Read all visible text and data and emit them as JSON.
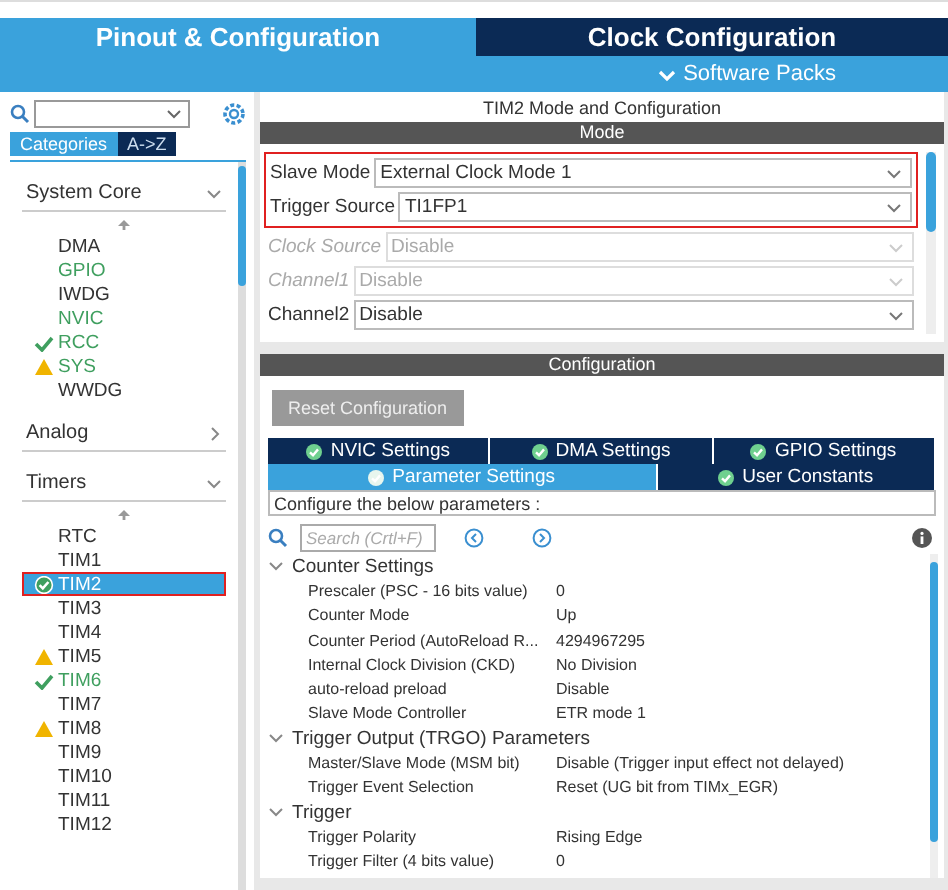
{
  "header": {
    "tabs": [
      {
        "label": "Pinout & Configuration",
        "selected": true
      },
      {
        "label": "Clock Configuration",
        "selected": false
      }
    ],
    "software_packs": "Software Packs"
  },
  "sidebar": {
    "tabs": [
      {
        "label": "Categories",
        "selected": true
      },
      {
        "label": "A->Z",
        "selected": false
      }
    ],
    "groups": [
      {
        "label": "System Core",
        "expanded": true,
        "items": [
          {
            "label": "DMA",
            "kind": "plain",
            "active": false,
            "selected": false,
            "annotated": false
          },
          {
            "label": "GPIO",
            "kind": "plain",
            "active": true,
            "selected": false,
            "annotated": false
          },
          {
            "label": "IWDG",
            "kind": "plain",
            "active": false,
            "selected": false,
            "annotated": false
          },
          {
            "label": "NVIC",
            "kind": "plain",
            "active": true,
            "selected": false,
            "annotated": false
          },
          {
            "label": "RCC",
            "kind": "ok",
            "active": true,
            "selected": false,
            "annotated": false
          },
          {
            "label": "SYS",
            "kind": "warning",
            "active": true,
            "selected": false,
            "annotated": false
          },
          {
            "label": "WWDG",
            "kind": "plain",
            "active": false,
            "selected": false,
            "annotated": false
          }
        ]
      },
      {
        "label": "Analog",
        "expanded": false
      },
      {
        "label": "Timers",
        "expanded": true,
        "items": [
          {
            "label": "RTC",
            "kind": "plain",
            "active": false,
            "selected": false,
            "annotated": false
          },
          {
            "label": "TIM1",
            "kind": "plain",
            "active": false,
            "selected": false,
            "annotated": false
          },
          {
            "label": "TIM2",
            "kind": "configured",
            "active": true,
            "selected": true,
            "annotated": true
          },
          {
            "label": "TIM3",
            "kind": "plain",
            "active": false,
            "selected": false,
            "annotated": false
          },
          {
            "label": "TIM4",
            "kind": "plain",
            "active": false,
            "selected": false,
            "annotated": false
          },
          {
            "label": "TIM5",
            "kind": "warning",
            "active": false,
            "selected": false,
            "annotated": false
          },
          {
            "label": "TIM6",
            "kind": "ok",
            "active": true,
            "selected": false,
            "annotated": false
          },
          {
            "label": "TIM7",
            "kind": "plain",
            "active": false,
            "selected": false,
            "annotated": false
          },
          {
            "label": "TIM8",
            "kind": "warning",
            "active": false,
            "selected": false,
            "annotated": false
          },
          {
            "label": "TIM9",
            "kind": "plain",
            "active": false,
            "selected": false,
            "annotated": false
          },
          {
            "label": "TIM10",
            "kind": "plain",
            "active": false,
            "selected": false,
            "annotated": false
          },
          {
            "label": "TIM11",
            "kind": "plain",
            "active": false,
            "selected": false,
            "annotated": false
          },
          {
            "label": "TIM12",
            "kind": "plain",
            "active": false,
            "selected": false,
            "annotated": false
          }
        ]
      }
    ]
  },
  "main": {
    "title": "TIM2 Mode and Configuration",
    "mode_heading": "Mode",
    "fields": [
      {
        "label": "Slave Mode",
        "value": "External Clock Mode 1",
        "disabled": false,
        "annotated": true
      },
      {
        "label": "Trigger Source",
        "value": "TI1FP1",
        "disabled": false,
        "annotated": true
      },
      {
        "label": "Clock Source",
        "value": "Disable",
        "disabled": true,
        "annotated": false
      },
      {
        "label": "Channel1",
        "value": "Disable",
        "disabled": true,
        "annotated": false
      },
      {
        "label": "Channel2",
        "value": "Disable",
        "disabled": false,
        "annotated": false
      }
    ],
    "config_heading": "Configuration",
    "reset_button": {
      "label": "Reset Configuration",
      "disabled": true
    },
    "tab_rows": [
      [
        {
          "label": "NVIC Settings",
          "selected": false
        },
        {
          "label": "DMA Settings",
          "selected": false
        },
        {
          "label": "GPIO Settings",
          "selected": false
        }
      ],
      [
        {
          "label": "Parameter Settings",
          "selected": true
        },
        {
          "label": "User Constants",
          "selected": false
        }
      ]
    ],
    "hint": "Configure the below parameters :",
    "search": {
      "placeholder": "Search (Crtl+F)"
    },
    "param_groups": [
      {
        "label": "Counter Settings",
        "expanded": true,
        "rows": [
          {
            "name": "Prescaler (PSC - 16 bits value)",
            "value": "0"
          },
          {
            "name": "Counter Mode",
            "value": "Up"
          },
          {
            "name": "Counter Period (AutoReload R...",
            "value": "4294967295"
          },
          {
            "name": "Internal Clock Division (CKD)",
            "value": "No Division"
          },
          {
            "name": "auto-reload preload",
            "value": "Disable"
          },
          {
            "name": "Slave Mode Controller",
            "value": "ETR mode 1"
          }
        ]
      },
      {
        "label": "Trigger Output (TRGO) Parameters",
        "expanded": true,
        "rows": [
          {
            "name": "Master/Slave Mode (MSM bit)",
            "value": "Disable (Trigger input effect not delayed)"
          },
          {
            "name": "Trigger Event Selection",
            "value": "Reset (UG bit from TIMx_EGR)"
          }
        ]
      },
      {
        "label": "Trigger",
        "expanded": true,
        "rows": [
          {
            "name": "Trigger Polarity",
            "value": "Rising Edge"
          },
          {
            "name": "Trigger Filter (4 bits value)",
            "value": "0"
          }
        ]
      }
    ]
  }
}
